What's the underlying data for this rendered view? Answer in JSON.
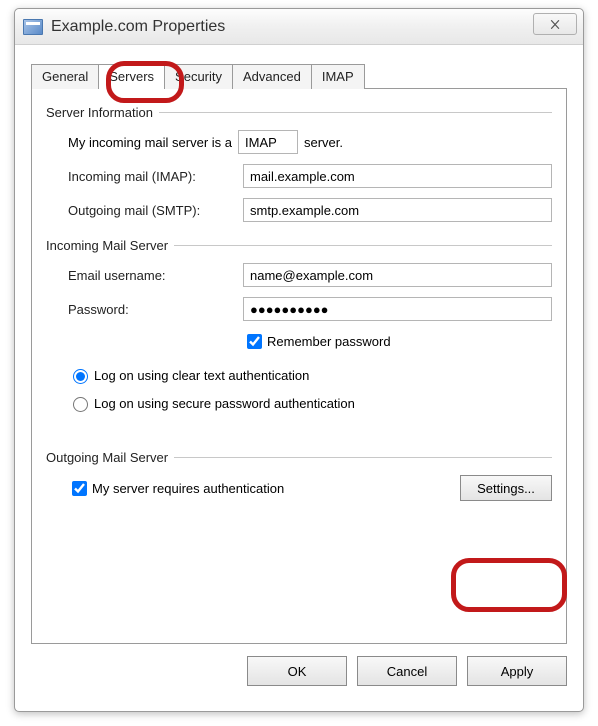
{
  "window": {
    "title": "Example.com Properties",
    "close_label": "✕"
  },
  "tabs": {
    "general": "General",
    "servers": "Servers",
    "security": "Security",
    "advanced": "Advanced",
    "imap": "IMAP",
    "active": "servers"
  },
  "server_info": {
    "group_label": "Server Information",
    "incoming_type_prefix": "My incoming mail server is a",
    "incoming_type_value": "IMAP",
    "incoming_type_suffix": "server.",
    "incoming_label": "Incoming mail (IMAP):",
    "incoming_value": "mail.example.com",
    "outgoing_label": "Outgoing mail (SMTP):",
    "outgoing_value": "smtp.example.com"
  },
  "incoming_server": {
    "group_label": "Incoming Mail Server",
    "username_label": "Email username:",
    "username_value": "name@example.com",
    "password_label": "Password:",
    "password_value": "●●●●●●●●●●",
    "remember_label": "Remember password",
    "remember_checked": true,
    "auth_clear": "Log on using clear text authentication",
    "auth_spa": "Log on using secure password authentication",
    "auth_selected": "clear"
  },
  "outgoing_server": {
    "group_label": "Outgoing Mail Server",
    "requires_auth_label": "My server requires authentication",
    "requires_auth_checked": true,
    "settings_button": "Settings..."
  },
  "buttons": {
    "ok": "OK",
    "cancel": "Cancel",
    "apply": "Apply"
  }
}
